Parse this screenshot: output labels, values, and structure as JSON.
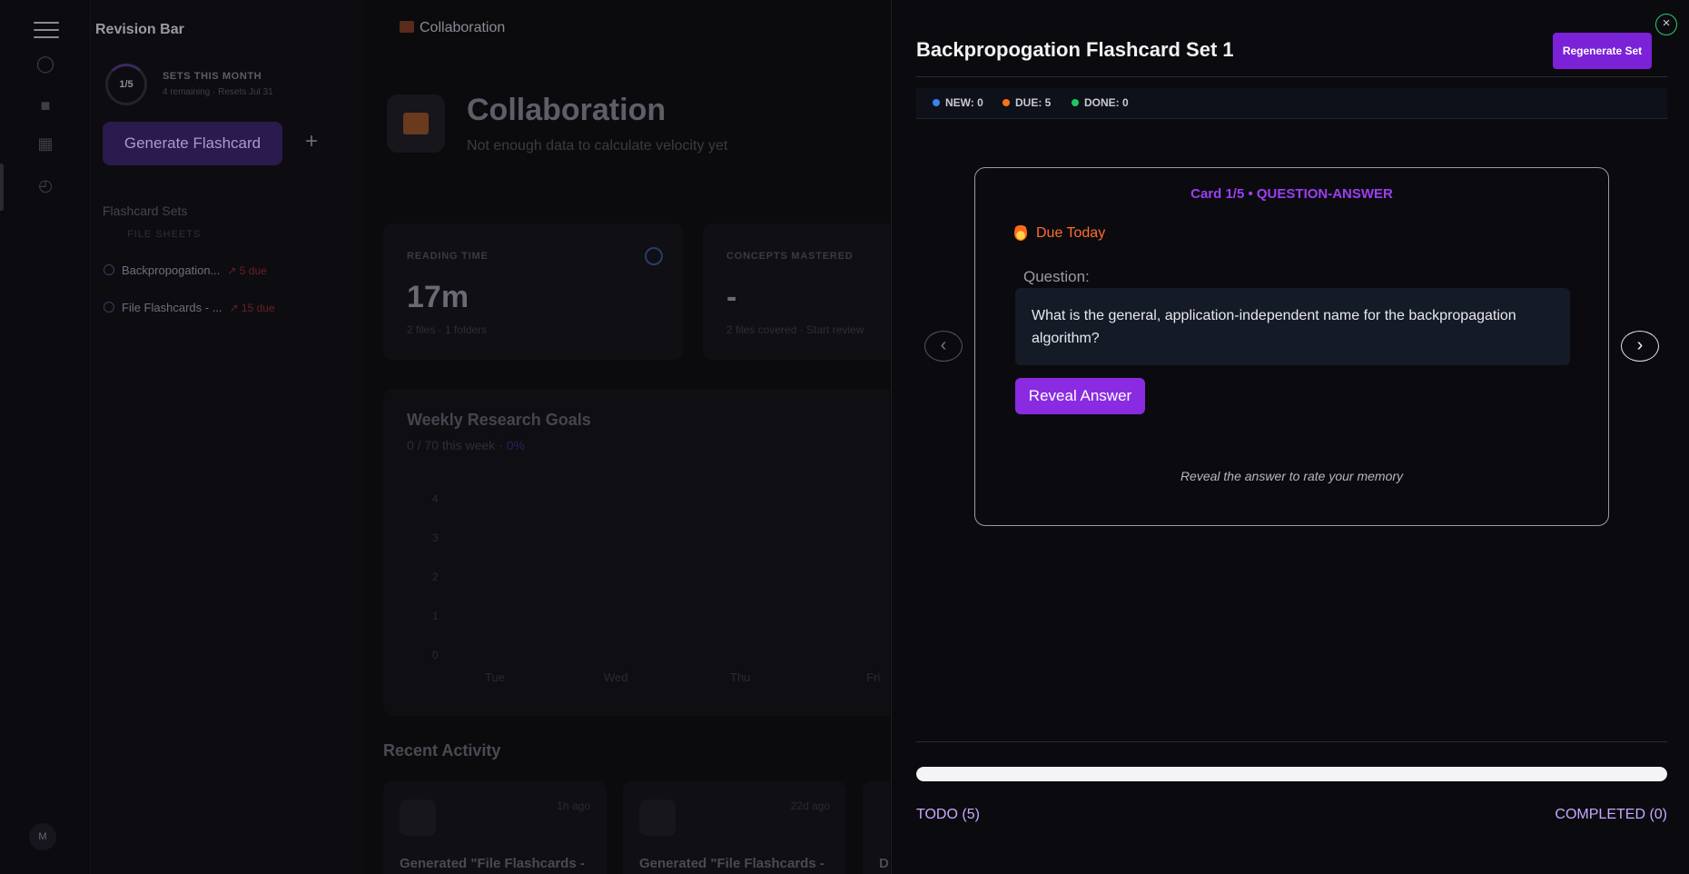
{
  "sidebar": {
    "brand": "Revision Bar",
    "usage_ring": "1/5",
    "usage_title": "SETS THIS MONTH",
    "usage_sub": "4 remaining · Resets Jul 31",
    "generate_label": "Generate Flashcard",
    "add_label": "+",
    "flashcard_sets_title": "Flashcard Sets",
    "file_sheets_label": "FILE SHEETS",
    "items": [
      {
        "name": "Backpropogation...",
        "due": "↗ 5 due"
      },
      {
        "name": "File Flashcards - ...",
        "due": "↗ 15 due"
      }
    ],
    "avatar_initial": "M"
  },
  "main": {
    "breadcrumb": "Collaboration",
    "title": "Collaboration",
    "subtitle": "Not enough data to calculate velocity yet",
    "stats": [
      {
        "label": "READING TIME",
        "value": "17m",
        "sub": "2 files · 1 folders"
      },
      {
        "label": "CONCEPTS MASTERED",
        "value": "-",
        "sub": "2 files covered · Start review"
      }
    ],
    "goals": {
      "title": "Weekly Research Goals",
      "sub": "0 / 70 this week · ",
      "pct": "0%",
      "y_ticks": [
        "4",
        "3",
        "2",
        "1",
        "0"
      ],
      "x_ticks": [
        "Tue",
        "Wed",
        "Thu",
        "Fri"
      ]
    },
    "recent_title": "Recent Activity",
    "activity": [
      {
        "ago": "1h ago",
        "text": "Generated \"File Flashcards -"
      },
      {
        "ago": "22d ago",
        "text": "Generated \"File Flashcards -"
      },
      {
        "ago": "",
        "text": "D"
      }
    ]
  },
  "drawer": {
    "title": "Backpropogation Flashcard Set 1",
    "regenerate_label": "Regenerate Set",
    "close_label": "×",
    "stats": [
      {
        "label": "NEW: 0",
        "color": "#3b82f6"
      },
      {
        "label": "DUE: 5",
        "color": "#f97316"
      },
      {
        "label": "DONE: 0",
        "color": "#22c55e"
      }
    ],
    "card": {
      "header": "Card 1/5 • QUESTION-ANSWER",
      "due_label": "Due Today",
      "question_label": "Question:",
      "question": "What is the general, application-independent name for the backpropagation algorithm?",
      "reveal_label": "Reveal Answer",
      "hint": "Reveal the answer to rate your memory"
    },
    "nav": {
      "prev_icon": "‹",
      "next_icon": "›"
    },
    "progress": 1.0,
    "todo_label": "TODO (5)",
    "completed_label": "COMPLETED (0)"
  },
  "colors": {
    "accent": "#7b22d8",
    "accent_text": "#9b3ff0",
    "due": "#ff6b2e",
    "tab_text": "#c7a9ff"
  }
}
